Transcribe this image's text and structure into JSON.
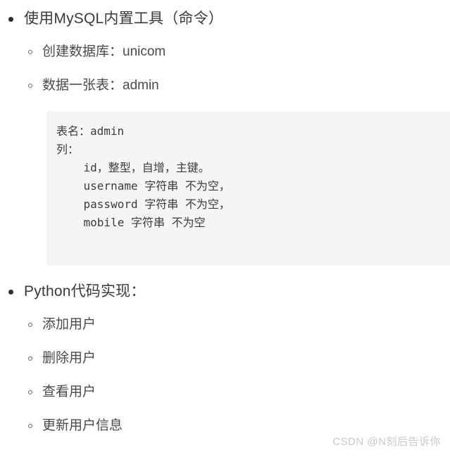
{
  "document": {
    "background_color": "#ffffff",
    "text_color": "#3a3a3a"
  },
  "outline": [
    {
      "level": 1,
      "label": "使用MySQL内置工具（命令）",
      "children": [
        {
          "level": 2,
          "label": "创建数据库：unicom"
        },
        {
          "level": 2,
          "label": "数据一张表：admin"
        }
      ]
    },
    {
      "level": 1,
      "label": "Python代码实现：",
      "children": [
        {
          "level": 2,
          "label": "添加用户"
        },
        {
          "level": 2,
          "label": "删除用户"
        },
        {
          "level": 2,
          "label": "查看用户"
        },
        {
          "level": 2,
          "label": "更新用户信息"
        }
      ]
    }
  ],
  "code_block": {
    "background_color": "#f5f5f5",
    "text_color": "#3c3c3c",
    "lines": [
      "表名：admin",
      "列：",
      "    id，整型，自增，主键。",
      "    username 字符串 不为空，",
      "    password 字符串 不为空，",
      "    mobile 字符串 不为空"
    ],
    "content": "表名：admin\n列：\n    id，整型，自增，主键。\n    username 字符串 不为空，\n    password 字符串 不为空，\n    mobile 字符串 不为空"
  },
  "watermark": {
    "text": "CSDN @N刻后告诉你",
    "color": "#c9c9c9"
  }
}
